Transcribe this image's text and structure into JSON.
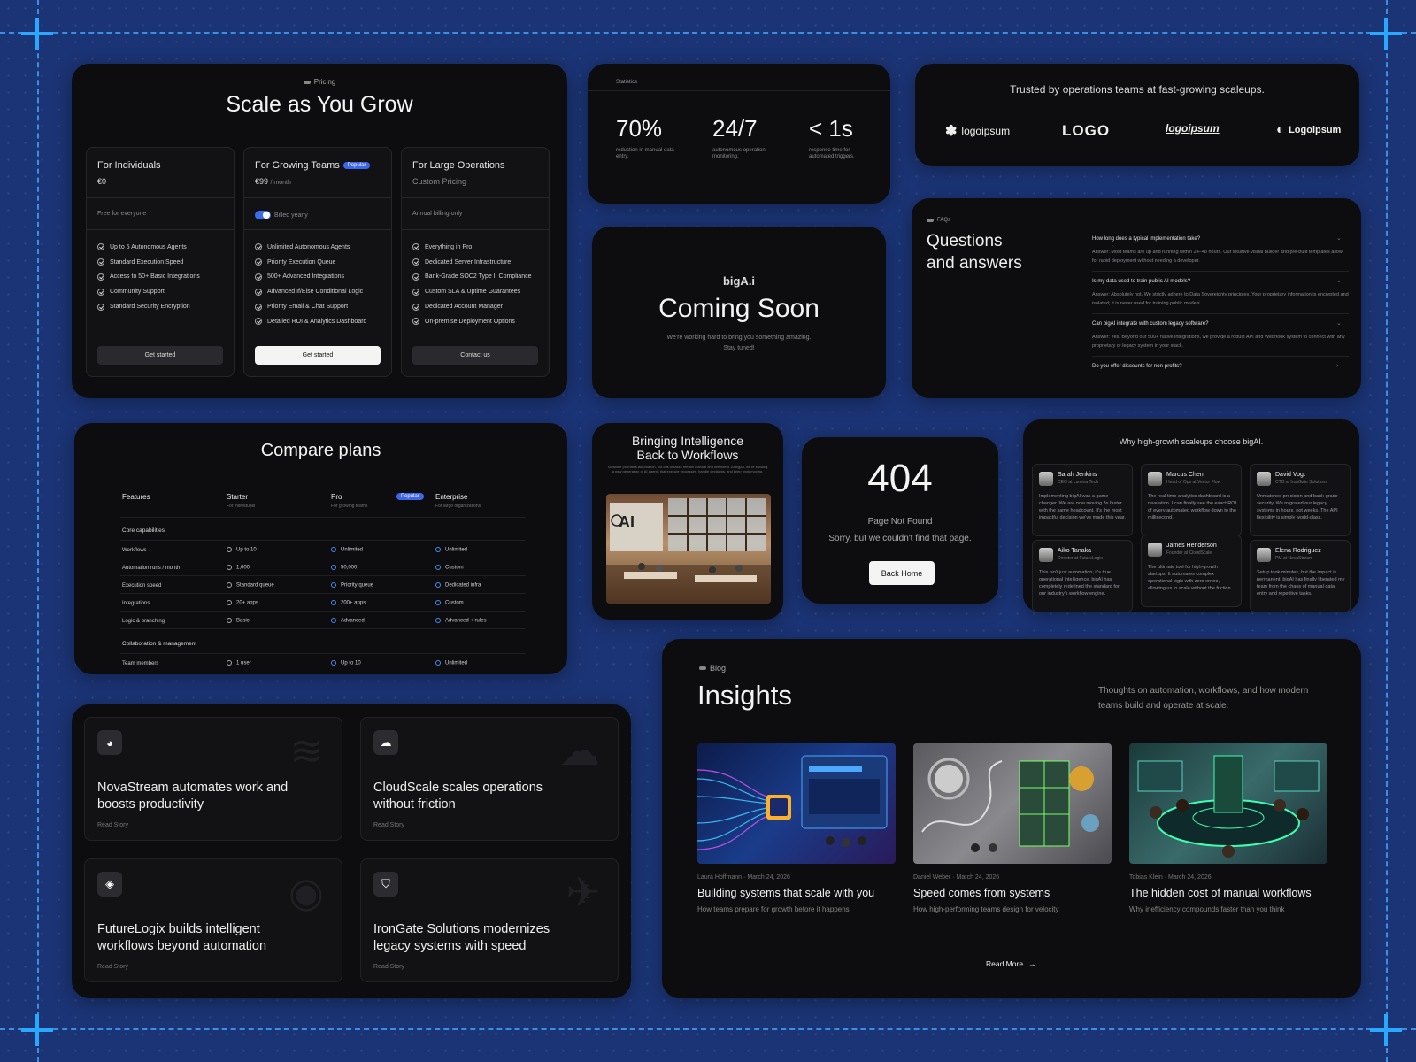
{
  "pricing": {
    "tag": "Pricing",
    "title": "Scale as You Grow",
    "plans": [
      {
        "name": "For Individuals",
        "price": "€0",
        "price_suffix": "",
        "note": "Free for everyone",
        "features": [
          "Up to 5 Autonomous Agents",
          "Standard Execution Speed",
          "Access to 50+ Basic Integrations",
          "Community Support",
          "Standard Security Encryption"
        ],
        "button": "Get started"
      },
      {
        "name": "For Growing Teams",
        "badge": "Popular",
        "price": "€99",
        "price_suffix": "/ month",
        "note": "Billed yearly",
        "features": [
          "Unlimited Autonomous Agents",
          "Priority Execution Queue",
          "500+ Advanced Integrations",
          "Advanced If/Else Conditional Logic",
          "Priority Email & Chat Support",
          "Detailed ROI & Analytics Dashboard"
        ],
        "button": "Get started"
      },
      {
        "name": "For Large Operations",
        "price": "Custom Pricing",
        "price_suffix": "",
        "note": "Annual billing only",
        "features": [
          "Everything in Pro",
          "Dedicated Server Infrastructure",
          "Bank-Grade SOC2 Type II Compliance",
          "Custom SLA & Uptime Guarantees",
          "Dedicated Account Manager",
          "On-premise Deployment Options"
        ],
        "button": "Contact us"
      }
    ]
  },
  "statistics": {
    "tag": "Statistics",
    "items": [
      {
        "value": "70%",
        "desc": "reduction in manual data entry."
      },
      {
        "value": "24/7",
        "desc": "autonomous operation monitoring."
      },
      {
        "value": "< 1s",
        "desc": "response time for automated triggers."
      }
    ]
  },
  "logos": {
    "title": "Trusted by operations teams at fast-growing scaleups.",
    "items": [
      "logoipsum",
      "LOGO",
      "logoipsum",
      "Logoipsum"
    ]
  },
  "coming_soon": {
    "brand": "bigA.i",
    "title": "Coming Soon",
    "text1": "We're working hard to bring you something amazing.",
    "text2": "Stay tuned!"
  },
  "faq": {
    "tag": "FAQs",
    "title1": "Questions",
    "title2": "and answers",
    "items": [
      {
        "q": "How long does a typical implementation take?",
        "a": "Answer: Most teams are up and running within 24–48 hours. Our intuitive visual builder and pre-built templates allow for rapid deployment without needing a developer."
      },
      {
        "q": "Is my data used to train public AI models?",
        "a": "Answer: Absolutely not. We strictly adhere to Data Sovereignty principles. Your proprietary information is encrypted and isolated; it is never used for training public models."
      },
      {
        "q": "Can bigAI integrate with custom legacy software?",
        "a": "Answer: Yes. Beyond our 500+ native integrations, we provide a robust API and Webhook system to connect with any proprietary or legacy system in your stack."
      },
      {
        "q": "Do you offer discounts for non-profits?",
        "a": ""
      }
    ]
  },
  "compare": {
    "title": "Compare plans",
    "columns": [
      {
        "name": "Features",
        "sub": ""
      },
      {
        "name": "Starter",
        "sub": "For individuals"
      },
      {
        "name": "Pro",
        "sub": "For growing teams",
        "badge": "Popular"
      },
      {
        "name": "Enterprise",
        "sub": "For large organizations"
      }
    ],
    "section1": "Core capabilities",
    "rows": [
      [
        "Workflows",
        "Up to 10",
        "Unlimited",
        "Unlimited"
      ],
      [
        "Automation runs / month",
        "1,000",
        "50,000",
        "Custom"
      ],
      [
        "Execution speed",
        "Standard queue",
        "Priority queue",
        "Dedicated infra"
      ],
      [
        "Integrations",
        "20+ apps",
        "200+ apps",
        "Custom"
      ],
      [
        "Logic & branching",
        "Basic",
        "Advanced",
        "Advanced + rules"
      ]
    ],
    "section2": "Collaboration & management",
    "rows2": [
      [
        "Team members",
        "1 user",
        "Up to 10",
        "Unlimited"
      ]
    ]
  },
  "hero": {
    "title1": "Bringing Intelligence",
    "title2": "Back to Workflows",
    "text": "Software promises automation, but lots of tasks remain manual and inefficient. At bigA.i, we're building a new generation of AI agents that execute processes, handle decisions, and keep work moving."
  },
  "not_found": {
    "code": "404",
    "title": "Page Not Found",
    "text": "Sorry, but we couldn't find that page.",
    "button": "Back Home"
  },
  "testimonials": {
    "title": "Why high-growth scaleups choose bigAI.",
    "items": [
      {
        "name": "Sarah Jenkins",
        "role": "CEO at Lumina Tech",
        "text": "Implementing bigAI was a game-changer. We are now moving 3x faster with the same headcount. It's the most impactful decision we've made this year."
      },
      {
        "name": "Marcus Chen",
        "role": "Head of Ops at Vector Flow",
        "text": "The real-time analytics dashboard is a revelation. I can finally see the exact ROI of every automated workflow down to the millisecond."
      },
      {
        "name": "David Vogt",
        "role": "CTO at IronGate Solutions",
        "text": "Unmatched precision and bank-grade security. We migrated our legacy systems in hours, not weeks. The API flexibility is simply world-class."
      },
      {
        "name": "Aiko Tanaka",
        "role": "Director at FutureLogix",
        "text": "This isn't just automation; it's true operational intelligence. bigAI has completely redefined the standard for our industry's workflow engine."
      },
      {
        "name": "James Henderson",
        "role": "Founder at CloudScale",
        "text": "The ultimate tool for high-growth startups. It automates complex operational logic with zero errors, allowing us to scale without the friction."
      },
      {
        "name": "Elena Rodriguez",
        "role": "PM at NovaStream",
        "text": "Setup took minutes, but the impact is permanent. bigAI has finally liberated my team from the chaos of manual data entry and repetitive tasks."
      }
    ]
  },
  "cases": [
    {
      "title": "NovaStream automates work and boosts productivity",
      "link": "Read Story",
      "icon": "cookie-icon",
      "bg": "wind-icon"
    },
    {
      "title": "CloudScale scales operations without friction",
      "link": "Read Story",
      "icon": "cloud-icon",
      "bg": "cloud-icon"
    },
    {
      "title": "FutureLogix builds intelligent workflows beyond automation",
      "link": "Read Story",
      "icon": "logix-icon",
      "bg": "robot-icon"
    },
    {
      "title": "IronGate Solutions modernizes legacy systems with speed",
      "link": "Read Story",
      "icon": "shield-icon",
      "bg": "plane-icon"
    }
  ],
  "blog": {
    "tag": "Blog",
    "title": "Insights",
    "intro": "Thoughts on automation, workflows, and how modern teams build and operate at scale.",
    "posts": [
      {
        "author": "Laura Hoffmann",
        "date": "March 24, 2026",
        "title": "Building systems that scale with you",
        "subtitle": "How teams prepare for growth before it happens"
      },
      {
        "author": "Daniel Weber",
        "date": "March 24, 2026",
        "title": "Speed comes from systems",
        "subtitle": "How high-performing teams design for velocity"
      },
      {
        "author": "Tobias Klein",
        "date": "March 24, 2026",
        "title": "The hidden cost of manual workflows",
        "subtitle": "Why inefficiency compounds faster than you think"
      }
    ],
    "read_more": "Read More"
  }
}
